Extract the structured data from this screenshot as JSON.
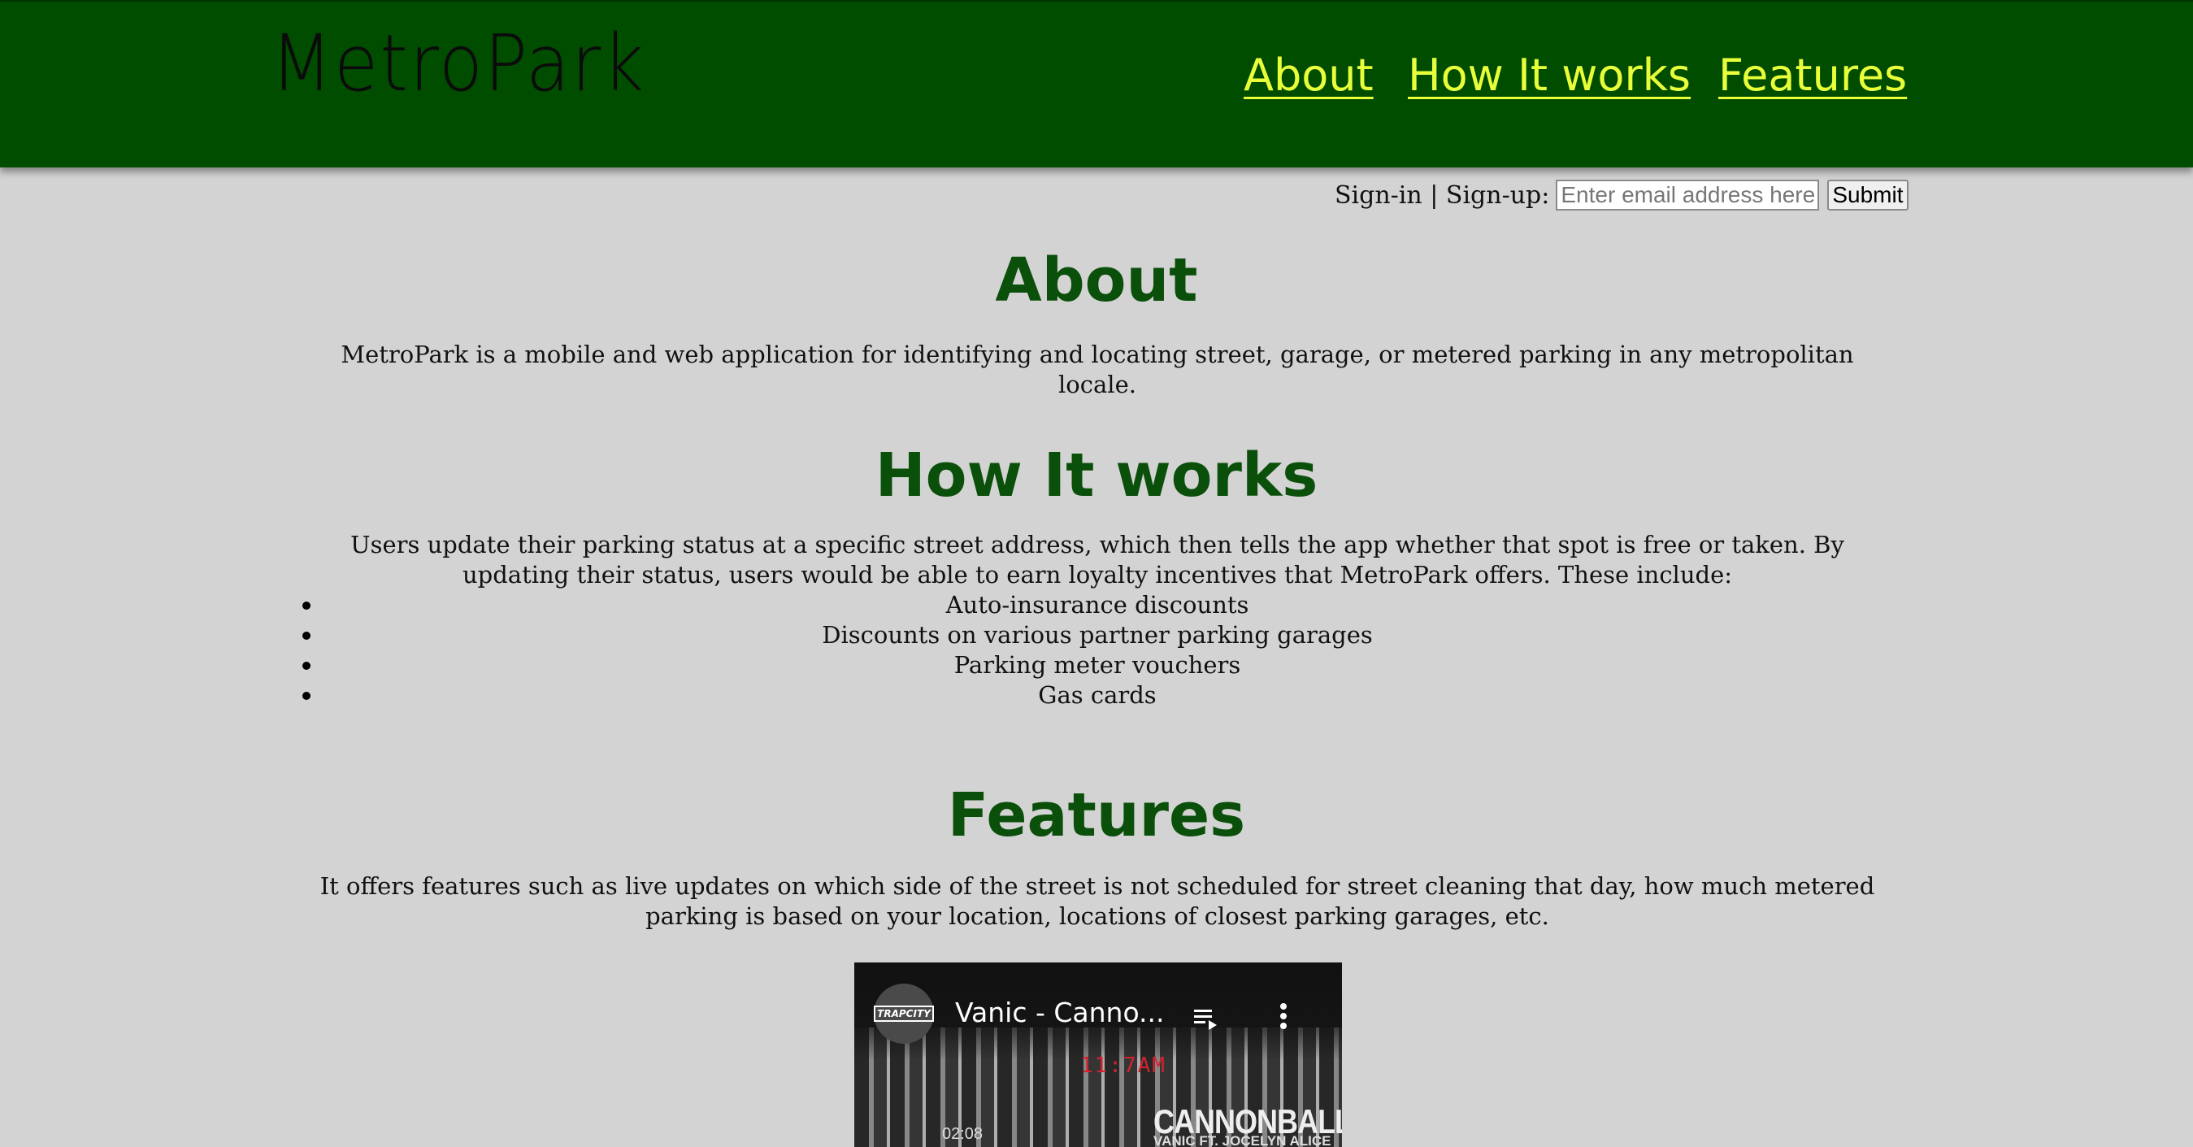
{
  "colors": {
    "header_bg": "#004d00",
    "page_bg": "#d3d3d3",
    "nav_link": "#e8ff3a",
    "heading": "#0a4f0a"
  },
  "header": {
    "logo": "MetroPark",
    "nav": [
      {
        "label": "About"
      },
      {
        "label": "How It works"
      },
      {
        "label": "Features"
      }
    ]
  },
  "signin": {
    "label": "Sign-in | Sign-up:",
    "placeholder": "Enter email address here",
    "submit_label": "Submit"
  },
  "about": {
    "title": "About",
    "text": "MetroPark is a mobile and web application for identifying and locating street, garage, or metered parking in any metropolitan locale."
  },
  "how": {
    "title": "How It works",
    "text": "Users update their parking status at a specific street address, which then tells the app whether that spot is free or taken. By updating their status, users would be able to earn loyalty incentives that MetroPark offers. These include:",
    "items": [
      "Auto-insurance discounts",
      "Discounts on various partner parking garages",
      "Parking meter vouchers",
      "Gas cards"
    ]
  },
  "features": {
    "title": "Features",
    "text": "It offers features such as live updates on which side of the street is not scheduled for street cleaning that day, how much metered parking is based on your location, locations of closest parking garages, etc."
  },
  "video": {
    "channel_badge": "TRAPCITY",
    "title": "Vanic - Canno...",
    "sign_text": "11:7AM",
    "overlay_title": "CANNONBALL",
    "overlay_sub": "VANIC FT. JOCELYN ALICE",
    "clock": "02:08",
    "icons": [
      "playlist-icon",
      "more-vert-icon"
    ]
  }
}
